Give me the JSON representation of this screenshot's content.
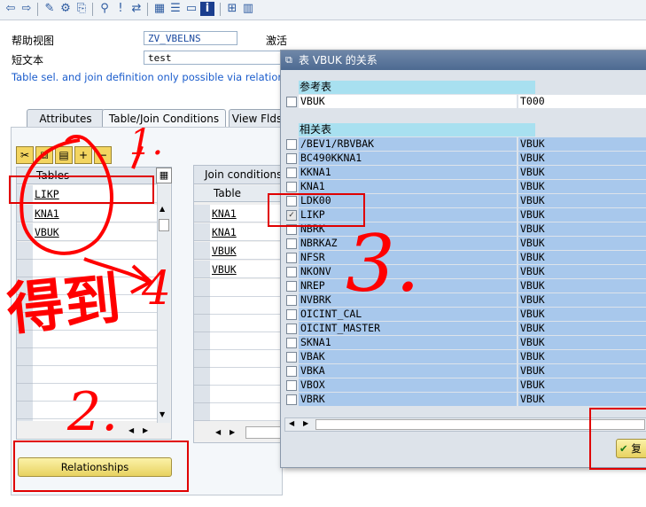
{
  "toolbar": {
    "icons": [
      "back-icon",
      "forward-icon",
      "edit-icon",
      "object-icon",
      "copy-icon",
      "hierarchy-icon",
      "activate-icon",
      "navigate-icon",
      "layout-icon",
      "where-used-icon",
      "display-icon",
      "info-icon",
      "technical-settings-icon",
      "grid-icon"
    ]
  },
  "header": {
    "view_label": "帮助视图",
    "view_value": "ZV_VBELNS",
    "status": "激活",
    "short_text_label": "短文本",
    "short_text_value": "test",
    "info": "Table sel. and join definition only possible via relationship"
  },
  "tabs": [
    {
      "label": "Attributes"
    },
    {
      "label": "Table/Join Conditions"
    },
    {
      "label": "View Flds"
    }
  ],
  "tables_panel": {
    "header": "Tables",
    "rows": [
      "LIKP",
      "KNA1",
      "VBUK"
    ]
  },
  "join_panel": {
    "caption": "Join conditions",
    "header": "Table",
    "rows": [
      "KNA1",
      "KNA1",
      "VBUK",
      "VBUK"
    ]
  },
  "relationships_button": "Relationships",
  "dialog": {
    "title": "表 VBUK 的关系",
    "ref_header": "参考表",
    "ref_rows": [
      {
        "table": "VBUK",
        "related": "T000"
      }
    ],
    "rel_header": "相关表",
    "rel_rows": [
      {
        "table": "/BEV1/RBVBAK",
        "ref": "VBUK",
        "checked": false
      },
      {
        "table": "BC490KKNA1",
        "ref": "VBUK",
        "checked": false
      },
      {
        "table": "KKNA1",
        "ref": "VBUK",
        "checked": false
      },
      {
        "table": "KNA1",
        "ref": "VBUK",
        "checked": false
      },
      {
        "table": "LDK00",
        "ref": "VBUK",
        "checked": false
      },
      {
        "table": "LIKP",
        "ref": "VBUK",
        "checked": true
      },
      {
        "table": "NBRK",
        "ref": "VBUK",
        "checked": false
      },
      {
        "table": "NBRKAZ",
        "ref": "VBUK",
        "checked": false
      },
      {
        "table": "NFSR",
        "ref": "VBUK",
        "checked": false
      },
      {
        "table": "NKONV",
        "ref": "VBUK",
        "checked": false
      },
      {
        "table": "NREP",
        "ref": "VBUK",
        "checked": false
      },
      {
        "table": "NVBRK",
        "ref": "VBUK",
        "checked": false
      },
      {
        "table": "OICINT_CAL",
        "ref": "VBUK",
        "checked": false
      },
      {
        "table": "OICINT_MASTER",
        "ref": "VBUK",
        "checked": false
      },
      {
        "table": "SKNA1",
        "ref": "VBUK",
        "checked": false
      },
      {
        "table": "VBAK",
        "ref": "VBUK",
        "checked": false
      },
      {
        "table": "VBKA",
        "ref": "VBUK",
        "checked": false
      },
      {
        "table": "VBOX",
        "ref": "VBUK",
        "checked": false
      },
      {
        "table": "VBRK",
        "ref": "VBUK",
        "checked": false
      }
    ],
    "ok_button": "复"
  },
  "annotations": {
    "numbers": [
      "1.",
      "2.",
      "3.",
      "4"
    ],
    "handwriting": "得到"
  },
  "colors": {
    "annotation_red": "#ff0000",
    "selection_blue": "#a8c8ec",
    "header_cyan": "#a8e0f0"
  }
}
